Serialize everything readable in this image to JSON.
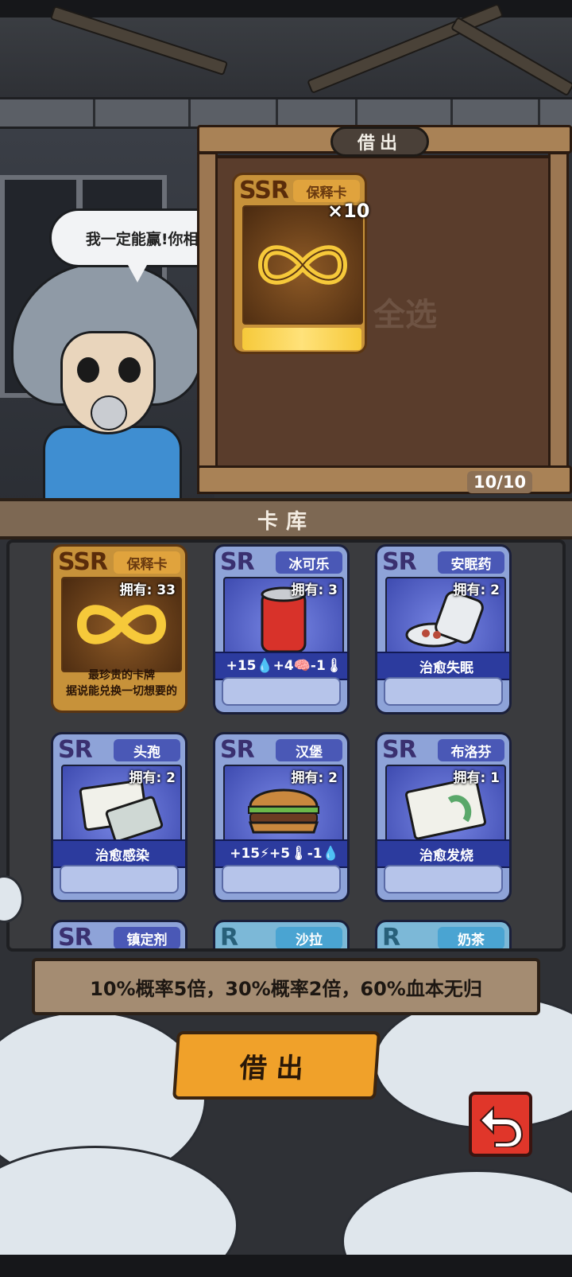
{
  "speech": "我一定能赢!你相信我!",
  "lend": {
    "title": "借出",
    "ghost_select": "全选",
    "slot_card": {
      "rank": "SSR",
      "tag": "保释卡",
      "multiplier": "×10"
    },
    "count": "10/10"
  },
  "library": {
    "title": "卡库",
    "cards": [
      {
        "rank": "SSR",
        "tag": "保释卡",
        "owned": "拥有: 33",
        "desc": [
          "最珍贵的卡牌",
          "据说能兑换一切想要的"
        ]
      },
      {
        "rank": "SR",
        "tag": "冰可乐",
        "owned": "拥有: 3",
        "effect": "+15💧+4🧠-1🌡"
      },
      {
        "rank": "SR",
        "tag": "安眠药",
        "owned": "拥有: 2",
        "effect": "治愈失眠"
      },
      {
        "rank": "SR",
        "tag": "头孢",
        "owned": "拥有: 2",
        "effect": "治愈感染"
      },
      {
        "rank": "SR",
        "tag": "汉堡",
        "owned": "拥有: 2",
        "effect": "+15⚡+5🌡-1💧"
      },
      {
        "rank": "SR",
        "tag": "布洛芬",
        "owned": "拥有: 1",
        "effect": "治愈发烧"
      },
      {
        "rank": "SR",
        "tag": "镇定剂"
      },
      {
        "rank": "R",
        "tag": "沙拉"
      },
      {
        "rank": "R",
        "tag": "奶茶"
      }
    ]
  },
  "odds": "10%概率5倍，30%概率2倍，60%血本无归",
  "buttons": {
    "lend": "借出"
  },
  "icons": {
    "back": "back-arrow-icon",
    "infinity": "infinity-icon"
  },
  "colors": {
    "ssr": "#c7923a",
    "sr": "#8ea3d8",
    "r": "#7cb8d7",
    "button": "#f0a12a",
    "back": "#e0362a"
  }
}
